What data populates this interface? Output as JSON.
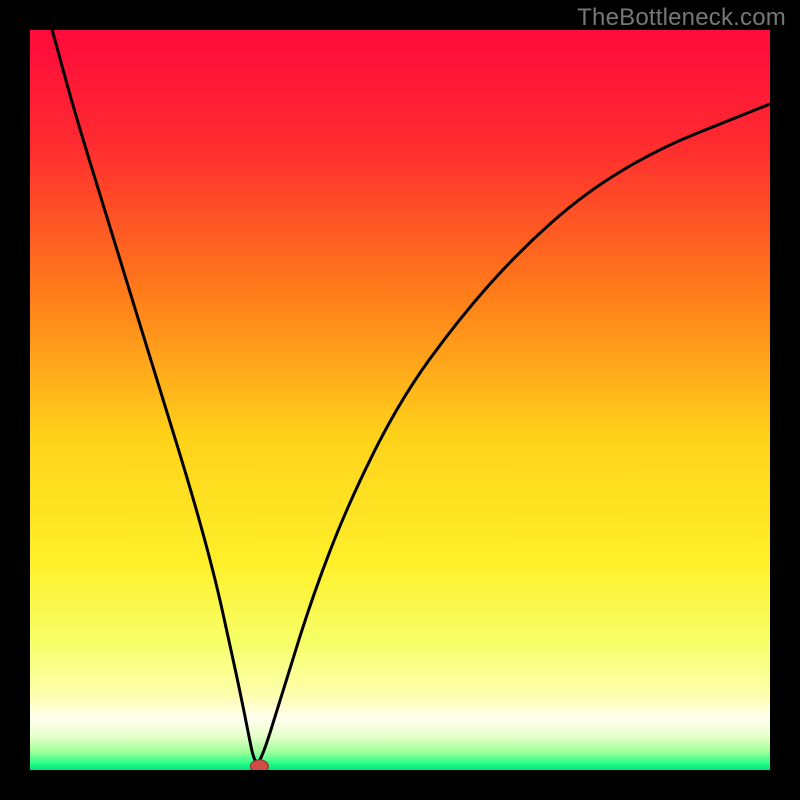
{
  "watermark": "TheBottleneck.com",
  "colors": {
    "frame": "#000000",
    "curve": "#000000",
    "marker_fill": "#cc4e44",
    "marker_stroke": "#8a2e27",
    "gradient_stops": [
      {
        "offset": 0.0,
        "color": "#ff0a3c"
      },
      {
        "offset": 0.15,
        "color": "#ff2a30"
      },
      {
        "offset": 0.35,
        "color": "#ff7a1a"
      },
      {
        "offset": 0.55,
        "color": "#ffd21a"
      },
      {
        "offset": 0.72,
        "color": "#fff02a"
      },
      {
        "offset": 0.83,
        "color": "#f6ff6a"
      },
      {
        "offset": 0.9,
        "color": "#ffffb0"
      },
      {
        "offset": 0.93,
        "color": "#fffff0"
      },
      {
        "offset": 0.955,
        "color": "#e6ffc8"
      },
      {
        "offset": 0.975,
        "color": "#a0ff9a"
      },
      {
        "offset": 0.99,
        "color": "#2eff8a"
      },
      {
        "offset": 1.0,
        "color": "#00e27a"
      }
    ]
  },
  "chart_data": {
    "type": "line",
    "title": "",
    "xlabel": "",
    "ylabel": "",
    "xlim": [
      0,
      100
    ],
    "ylim": [
      0,
      100
    ],
    "grid": false,
    "legend": false,
    "series": [
      {
        "name": "bottleneck-curve",
        "x": [
          3,
          6,
          10,
          14,
          18,
          22,
          25,
          27,
          28.5,
          29.5,
          30.2,
          31,
          34,
          38,
          43,
          50,
          58,
          66,
          75,
          85,
          95,
          100
        ],
        "y": [
          100,
          89,
          76,
          63,
          50,
          37,
          26,
          17,
          10,
          5,
          1.5,
          0.5,
          10,
          23,
          36,
          50,
          61,
          70,
          78,
          84,
          88,
          90
        ]
      }
    ],
    "marker": {
      "x": 31,
      "y": 0.5,
      "r": 1.1
    }
  }
}
